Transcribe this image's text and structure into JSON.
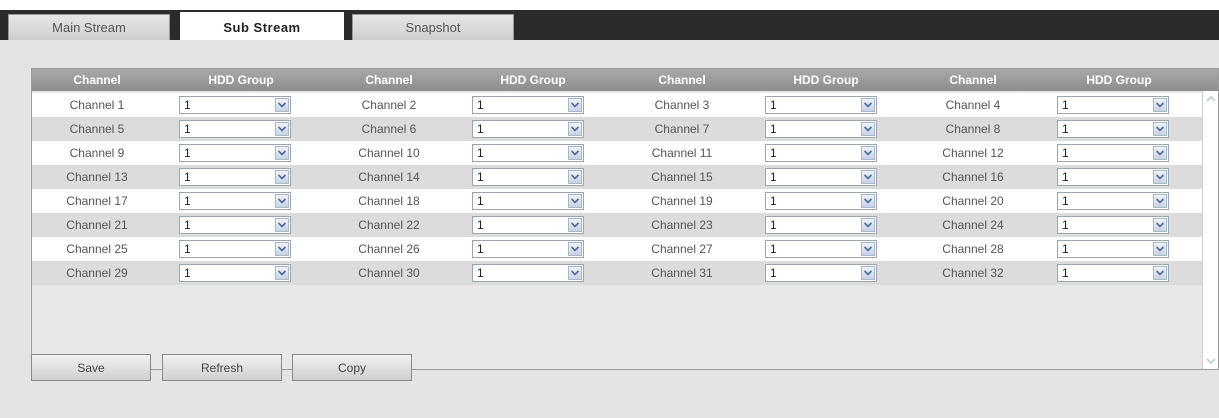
{
  "tabs": [
    {
      "label": "Main Stream"
    },
    {
      "label": "Sub Stream"
    },
    {
      "label": "Snapshot"
    }
  ],
  "table": {
    "headers": [
      "Channel",
      "HDD Group",
      "Channel",
      "HDD Group",
      "Channel",
      "HDD Group",
      "Channel",
      "HDD Group"
    ],
    "rows": [
      [
        {
          "channel": "Channel 1",
          "hdd": "1"
        },
        {
          "channel": "Channel 2",
          "hdd": "1"
        },
        {
          "channel": "Channel 3",
          "hdd": "1"
        },
        {
          "channel": "Channel 4",
          "hdd": "1"
        }
      ],
      [
        {
          "channel": "Channel 5",
          "hdd": "1"
        },
        {
          "channel": "Channel 6",
          "hdd": "1"
        },
        {
          "channel": "Channel 7",
          "hdd": "1"
        },
        {
          "channel": "Channel 8",
          "hdd": "1"
        }
      ],
      [
        {
          "channel": "Channel 9",
          "hdd": "1"
        },
        {
          "channel": "Channel 10",
          "hdd": "1"
        },
        {
          "channel": "Channel 11",
          "hdd": "1"
        },
        {
          "channel": "Channel 12",
          "hdd": "1"
        }
      ],
      [
        {
          "channel": "Channel 13",
          "hdd": "1"
        },
        {
          "channel": "Channel 14",
          "hdd": "1"
        },
        {
          "channel": "Channel 15",
          "hdd": "1"
        },
        {
          "channel": "Channel 16",
          "hdd": "1"
        }
      ],
      [
        {
          "channel": "Channel 17",
          "hdd": "1"
        },
        {
          "channel": "Channel 18",
          "hdd": "1"
        },
        {
          "channel": "Channel 19",
          "hdd": "1"
        },
        {
          "channel": "Channel 20",
          "hdd": "1"
        }
      ],
      [
        {
          "channel": "Channel 21",
          "hdd": "1"
        },
        {
          "channel": "Channel 22",
          "hdd": "1"
        },
        {
          "channel": "Channel 23",
          "hdd": "1"
        },
        {
          "channel": "Channel 24",
          "hdd": "1"
        }
      ],
      [
        {
          "channel": "Channel 25",
          "hdd": "1"
        },
        {
          "channel": "Channel 26",
          "hdd": "1"
        },
        {
          "channel": "Channel 27",
          "hdd": "1"
        },
        {
          "channel": "Channel 28",
          "hdd": "1"
        }
      ],
      [
        {
          "channel": "Channel 29",
          "hdd": "1"
        },
        {
          "channel": "Channel 30",
          "hdd": "1"
        },
        {
          "channel": "Channel 31",
          "hdd": "1"
        },
        {
          "channel": "Channel 32",
          "hdd": "1"
        }
      ]
    ]
  },
  "buttons": {
    "save": "Save",
    "refresh": "Refresh",
    "copy": "Copy"
  },
  "icons": {
    "dropdown": "chevron-down-icon",
    "scroll_up": "scroll-up-icon",
    "scroll_down": "scroll-down-icon"
  },
  "colors": {
    "header_bg": "#9a9a9a",
    "tabbar_bg": "#2b2b2b",
    "row_alt": "#dcdcdc"
  }
}
